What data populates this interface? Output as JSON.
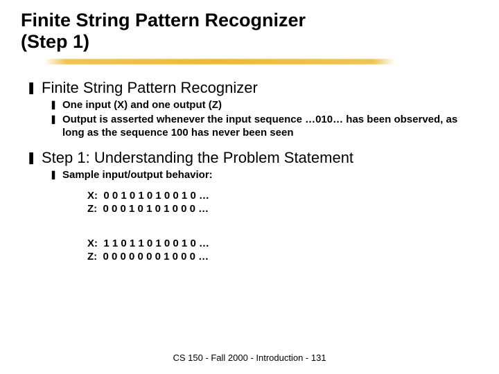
{
  "title_line1": "Finite String Pattern Recognizer",
  "title_line2": "(Step 1)",
  "bullets": {
    "b1": {
      "text": "Finite String Pattern Recognizer",
      "sub": [
        "One input (X) and one output (Z)",
        "Output is asserted whenever the input sequence …010… has been observed, as long as the sequence 100 has never been seen"
      ]
    },
    "b2": {
      "text": "Step 1: Understanding the Problem Statement",
      "sub": [
        "Sample input/output behavior:"
      ]
    }
  },
  "io": {
    "ex1": {
      "x_label": "X:",
      "x_vals": "0 0 1 0 1 0 1 0 0 1 0 …",
      "z_label": "Z:",
      "z_vals": "0 0 0 1 0 1 0 1 0 0 0 …"
    },
    "ex2": {
      "x_label": "X:",
      "x_vals": "1 1 0 1 1 0 1 0 0 1 0 …",
      "z_label": "Z:",
      "z_vals": "0 0 0 0 0 0 0 1 0 0 0 …"
    }
  },
  "footer": "CS 150 - Fall 2000 - Introduction - 131",
  "glyphs": {
    "lvl1": "❚",
    "lvl2": "❚"
  }
}
